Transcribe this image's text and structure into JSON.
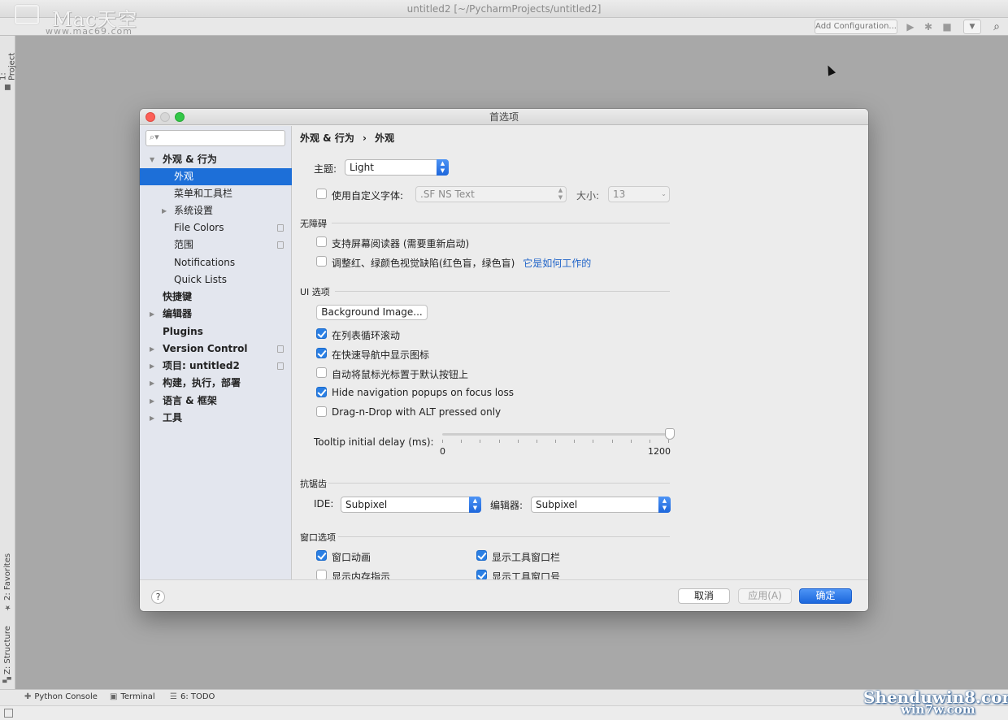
{
  "ide": {
    "title": "untitled2 [~/PycharmProjects/untitled2]",
    "add_configuration": "Add Configuration...",
    "logo_text": "Mac天空",
    "logo_url": "www.mac69.com",
    "left_tabs": [
      "1: Project",
      "2: Favorites",
      "Z: Structure"
    ],
    "bottom_tabs": [
      {
        "label": "Python Console",
        "icon": "python-icon"
      },
      {
        "label": "Terminal",
        "icon": "terminal-icon"
      },
      {
        "label": "6: TODO",
        "icon": "list-icon"
      }
    ],
    "watermark": "Shenduwin8.com",
    "watermark2": "win7w.com"
  },
  "dialog": {
    "title": "首选项",
    "search_placeholder": "",
    "tree": [
      {
        "label": "外观 & 行为",
        "expanded": true,
        "bold": true
      },
      {
        "label": "外观",
        "selected": true
      },
      {
        "label": "菜单和工具栏"
      },
      {
        "label": "系统设置",
        "collapsed": true
      },
      {
        "label": "File Colors",
        "copy": true
      },
      {
        "label": "范围",
        "copy": true
      },
      {
        "label": "Notifications"
      },
      {
        "label": "Quick Lists"
      },
      {
        "label": "快捷键",
        "bold": true
      },
      {
        "label": "编辑器",
        "bold": true,
        "collapsed": true
      },
      {
        "label": "Plugins",
        "bold": true
      },
      {
        "label": "Version Control",
        "bold": true,
        "collapsed": true,
        "copy": true
      },
      {
        "label": "项目: untitled2",
        "bold": true,
        "collapsed": true,
        "copy": true
      },
      {
        "label": "构建，执行，部署",
        "bold": true,
        "collapsed": true
      },
      {
        "label": "语言 & 框架",
        "bold": true,
        "collapsed": true
      },
      {
        "label": "工具",
        "bold": true,
        "collapsed": true
      }
    ],
    "breadcrumb": {
      "parent": "外观 & 行为",
      "sep": "›",
      "current": "外观"
    },
    "theme": {
      "label": "主题:",
      "value": "Light"
    },
    "custom_font": {
      "label": "使用自定义字体:",
      "checked": false,
      "font_value": ".SF NS Text",
      "size_label": "大小:",
      "size_value": "13"
    },
    "accessibility": {
      "title": "无障碍",
      "screen_reader": {
        "label": "支持屏幕阅读器 (需要重新启动)",
        "checked": false
      },
      "color_deficiency": {
        "label": "调整红、绿颜色视觉缺陷(红色盲，绿色盲)",
        "link": "它是如何工作的",
        "checked": false
      }
    },
    "ui_options": {
      "title": "UI 选项",
      "bg_button": "Background Image...",
      "checks": [
        {
          "label": "在列表循环滚动",
          "checked": true
        },
        {
          "label": "在快速导航中显示图标",
          "checked": true
        },
        {
          "label": "自动将鼠标光标置于默认按钮上",
          "checked": false
        },
        {
          "label": "Hide navigation popups on focus loss",
          "checked": true
        },
        {
          "label": "Drag-n-Drop with ALT pressed only",
          "checked": false
        }
      ],
      "tooltip_label": "Tooltip initial delay (ms):",
      "tooltip_min": "0",
      "tooltip_max": "1200",
      "tooltip_value": 1200
    },
    "antialias": {
      "title": "抗锯齿",
      "ide_label": "IDE:",
      "ide_value": "Subpixel",
      "editor_label": "编辑器:",
      "editor_value": "Subpixel"
    },
    "window_options": {
      "title": "窗口选项",
      "checks": [
        {
          "label": "窗口动画",
          "checked": true
        },
        {
          "label": "显示工具窗口栏",
          "checked": true
        },
        {
          "label": "显示内存指示",
          "checked": false
        },
        {
          "label": "显示工具窗口号",
          "checked": true
        }
      ]
    },
    "footer": {
      "help": "?",
      "cancel": "取消",
      "apply": "应用(A)",
      "ok": "确定"
    }
  }
}
